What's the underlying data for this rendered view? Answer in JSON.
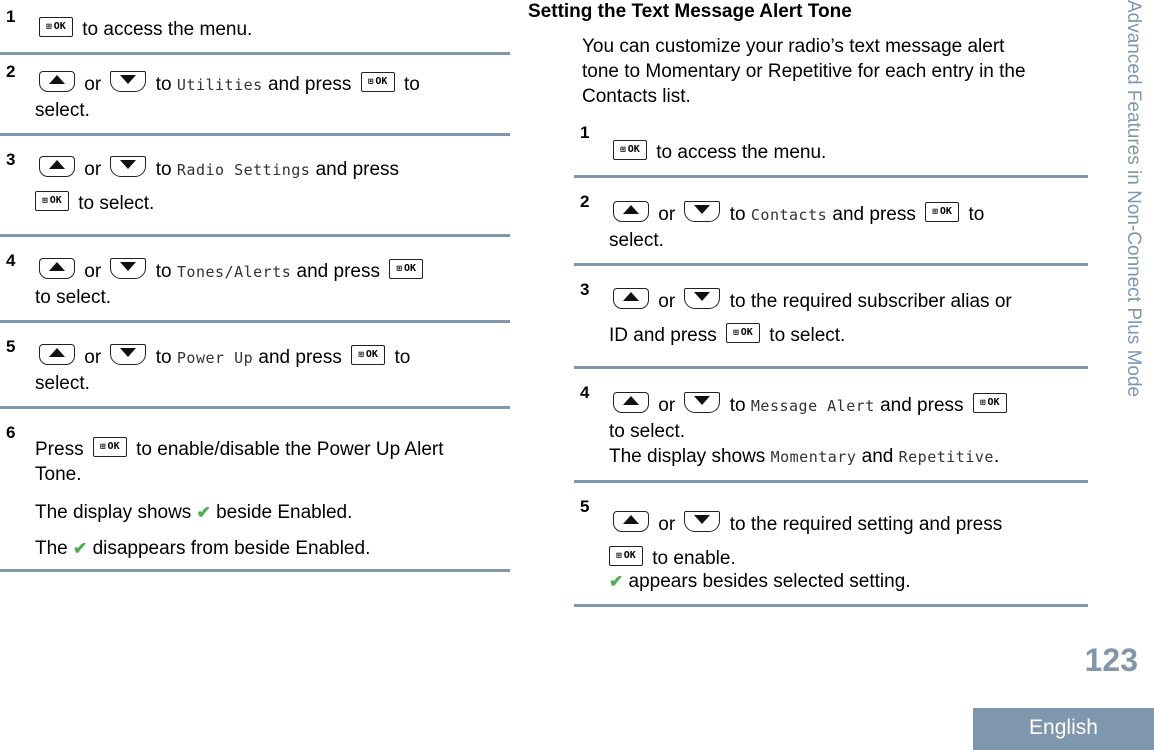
{
  "left": {
    "steps": [
      {
        "num": "1",
        "text_after_ok": "to access the menu."
      },
      {
        "num": "2",
        "or": "or",
        "to": "to",
        "target": "Utilities",
        "and_press": "and press",
        "after": "to",
        "line2": "select."
      },
      {
        "num": "3",
        "or": "or",
        "to": "to",
        "target": "Radio Settings",
        "and_press": "and press",
        "line2": "to select."
      },
      {
        "num": "4",
        "or": "or",
        "to": "to",
        "target": "Tones/Alerts",
        "and_press": "and press",
        "line2": "to select."
      },
      {
        "num": "5",
        "or": "or",
        "to": "to",
        "target": "Power Up",
        "and_press": "and press",
        "after": "to",
        "line2": "select."
      },
      {
        "num": "6",
        "press": "Press",
        "text": "to enable/disable the Power Up Alert",
        "line2": "Tone.",
        "result1_before": "The display shows",
        "result1_after": "beside Enabled.",
        "result2_before": "The",
        "result2_after": "disappears from beside Enabled."
      }
    ]
  },
  "right": {
    "section_title": "Setting the Text Message Alert Tone",
    "intro_lines": [
      "You can customize your radio’s text message alert",
      "tone to Momentary or Repetitive for each entry in the",
      "Contacts list."
    ],
    "steps": [
      {
        "num": "1",
        "text_after_ok": "to access the menu."
      },
      {
        "num": "2",
        "or": "or",
        "to": "to",
        "target": "Contacts",
        "and_press": "and press",
        "after": "to",
        "line2": "select."
      },
      {
        "num": "3",
        "or": "or",
        "text": "to the required subscriber alias or",
        "line2_before": "ID and press",
        "line2_after": "to select."
      },
      {
        "num": "4",
        "or": "or",
        "to": "to",
        "target": "Message Alert",
        "and_press": "and press",
        "line2": "to select.",
        "line3_before": "The display shows",
        "opt1": "Momentary",
        "and": "and",
        "opt2": "Repetitive",
        "end": "."
      },
      {
        "num": "5",
        "or": "or",
        "text": "to the required setting and press",
        "line2": "to enable.",
        "line3": "appears besides selected setting."
      }
    ]
  },
  "icons": {
    "ok_label": "OK",
    "ok_grid": "⊞",
    "check": "✔"
  },
  "side_title": "Advanced Features in Non-Connect Plus Mode",
  "page_number": "123",
  "language_tab": "English",
  "colors": {
    "accent": "#7f97ad",
    "check": "#4caf50"
  }
}
